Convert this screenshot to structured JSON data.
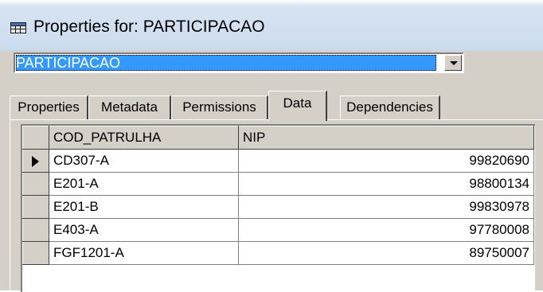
{
  "window": {
    "title": "Properties for: PARTICIPACAO"
  },
  "object_selector": {
    "selected": "PARTICIPACAO"
  },
  "tabs": [
    {
      "label": "Properties",
      "active": false
    },
    {
      "label": "Metadata",
      "active": false
    },
    {
      "label": "Permissions",
      "active": false
    },
    {
      "label": "Data",
      "active": true
    },
    {
      "label": "Dependencies",
      "active": false
    }
  ],
  "grid": {
    "columns": [
      "COD_PATRULHA",
      "NIP"
    ],
    "rows": [
      {
        "COD_PATRULHA": "CD307-A",
        "NIP": "99820690",
        "current": true
      },
      {
        "COD_PATRULHA": "E201-A",
        "NIP": "98800134",
        "current": false
      },
      {
        "COD_PATRULHA": "E201-B",
        "NIP": "99830978",
        "current": false
      },
      {
        "COD_PATRULHA": "E403-A",
        "NIP": "97780008",
        "current": false
      },
      {
        "COD_PATRULHA": "FGF1201-A",
        "NIP": "89750007",
        "current": false
      }
    ]
  },
  "colors": {
    "selection": "#3399ff",
    "face": "#d4d0c8"
  }
}
